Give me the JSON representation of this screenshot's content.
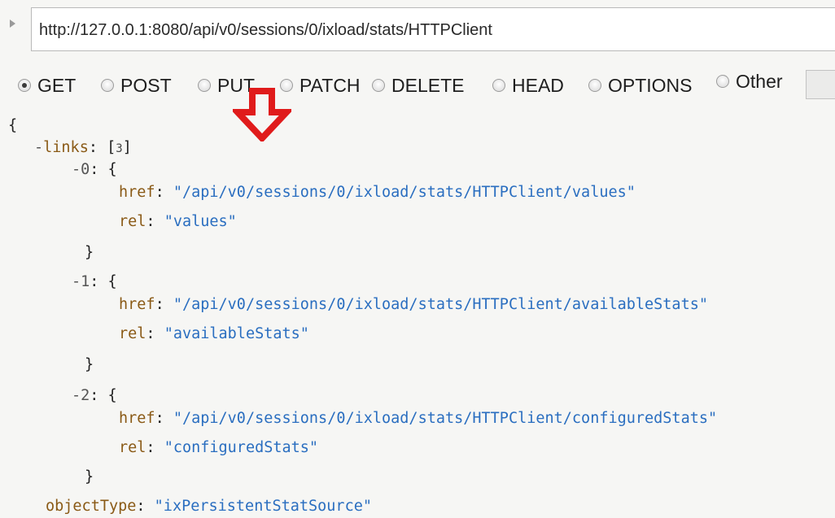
{
  "url_bar": {
    "value": "http://127.0.0.1:8080/api/v0/sessions/0/ixload/stats/HTTPClient"
  },
  "methods": [
    {
      "label": "GET",
      "checked": true
    },
    {
      "label": "POST",
      "checked": false
    },
    {
      "label": "PUT",
      "checked": false
    },
    {
      "label": "PATCH",
      "checked": false
    },
    {
      "label": "DELETE",
      "checked": false
    },
    {
      "label": "HEAD",
      "checked": false
    },
    {
      "label": "OPTIONS",
      "checked": false
    },
    {
      "label": "Other",
      "checked": false
    }
  ],
  "annotation": {
    "icon": "down-arrow-icon",
    "color": "#e01b1b"
  },
  "response": {
    "open_brace": "{",
    "links": {
      "collapse_toggle": "-",
      "key": "links",
      "count": "3",
      "items": [
        {
          "toggle": "-",
          "index": "0",
          "href_key": "href",
          "href": "\"/api/v0/sessions/0/ixload/stats/HTTPClient/values\"",
          "rel_key": "rel",
          "rel": "\"values\""
        },
        {
          "toggle": "-",
          "index": "1",
          "href_key": "href",
          "href": "\"/api/v0/sessions/0/ixload/stats/HTTPClient/availableStats\"",
          "rel_key": "rel",
          "rel": "\"availableStats\""
        },
        {
          "toggle": "-",
          "index": "2",
          "href_key": "href",
          "href": "\"/api/v0/sessions/0/ixload/stats/HTTPClient/configuredStats\"",
          "rel_key": "rel",
          "rel": "\"configuredStats\""
        }
      ]
    },
    "object_type": {
      "key": "objectType",
      "value": "\"ixPersistentStatSource\""
    }
  },
  "colors": {
    "key": "#8a5a16",
    "string": "#2a6ec0",
    "background": "#f6f6f4"
  }
}
